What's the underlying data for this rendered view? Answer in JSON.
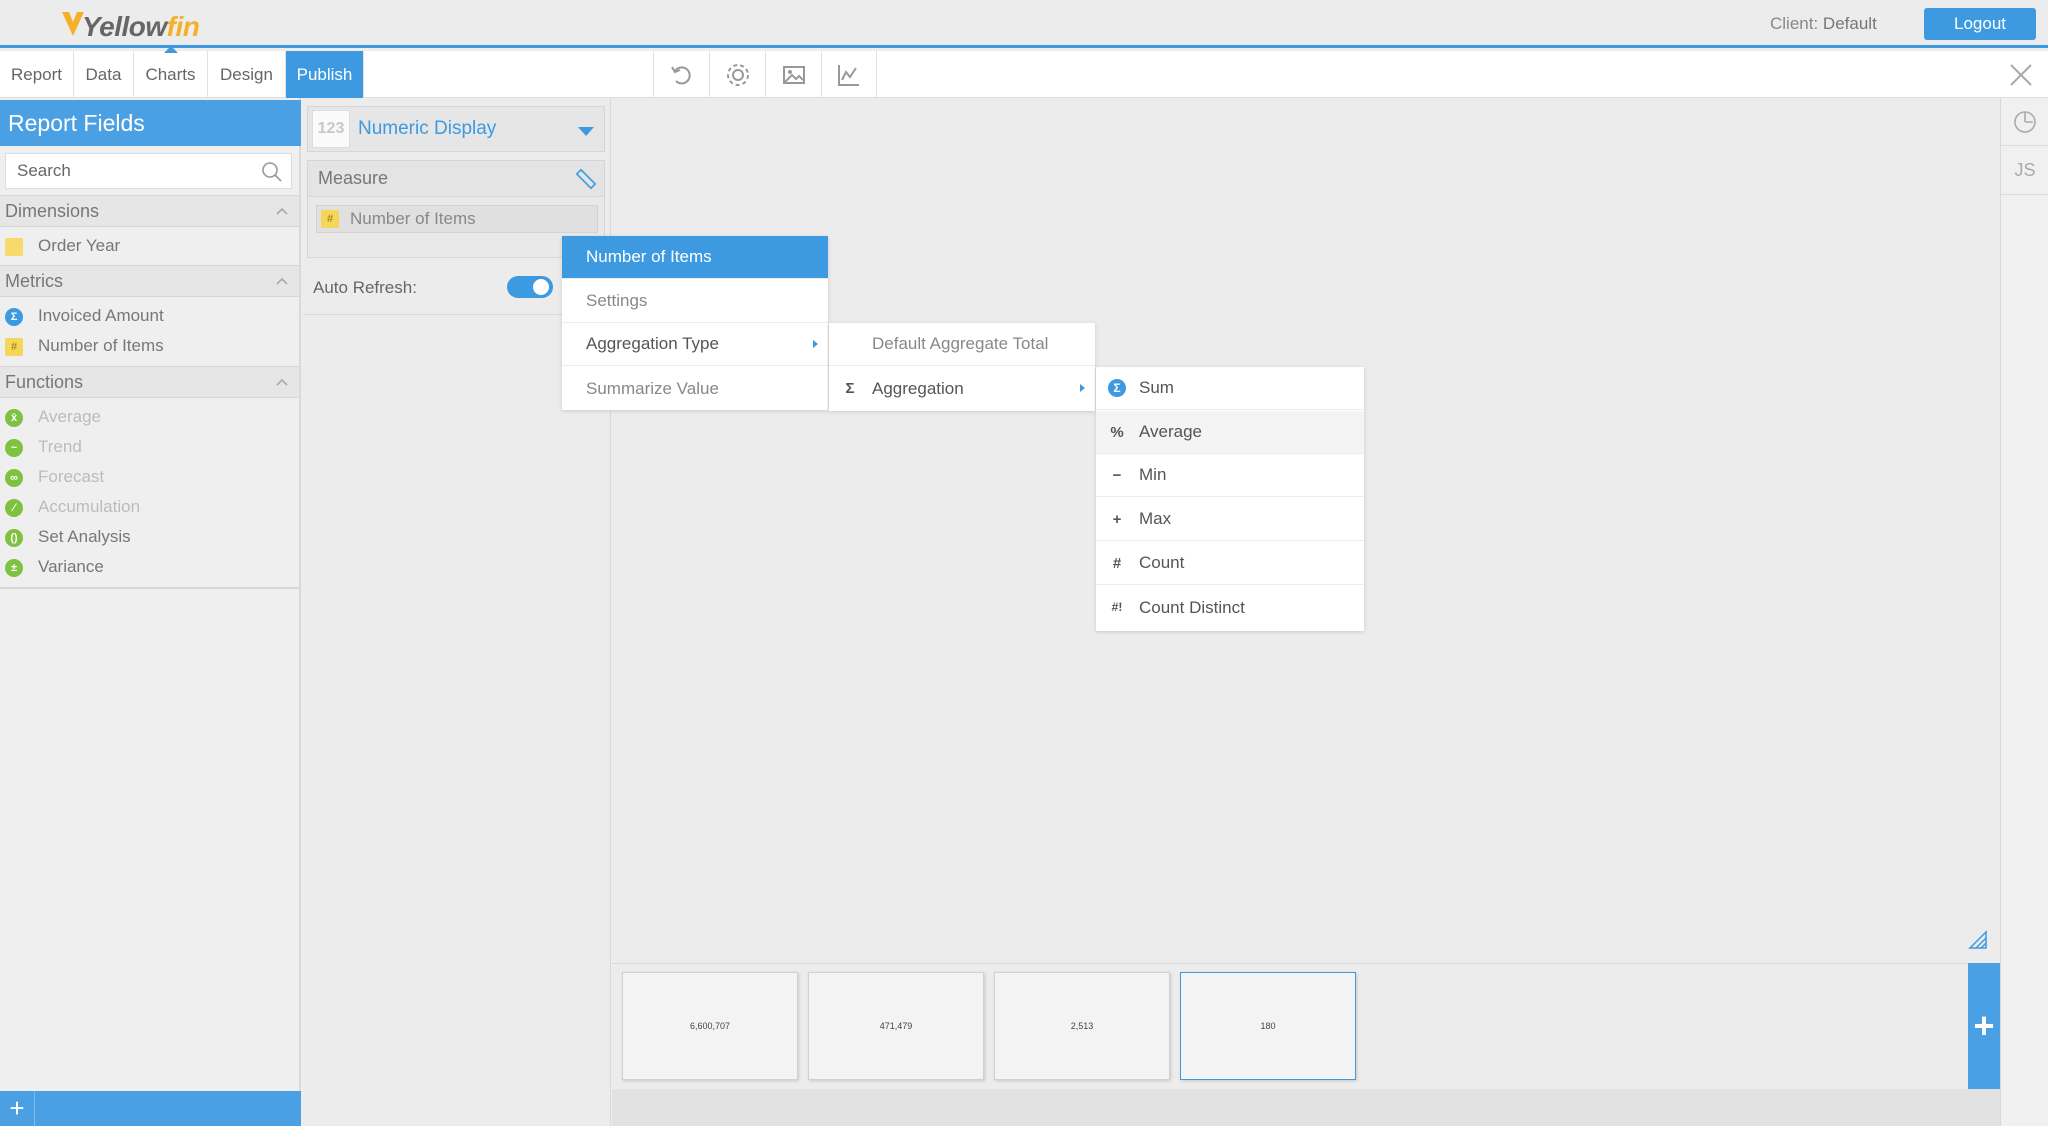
{
  "header": {
    "logo_text_1": "Yellow",
    "logo_text_2": "fin",
    "client_prefix": "Client:",
    "client_name": "Default",
    "logout_label": "Logout"
  },
  "tabs": [
    "Report",
    "Data",
    "Charts",
    "Design",
    "Publish"
  ],
  "active_tab": "Publish",
  "toolbar_icons": [
    "undo-icon",
    "gear-icon",
    "image-icon",
    "line-chart-icon"
  ],
  "left_panel": {
    "title": "Report Fields",
    "search_placeholder": "Search",
    "dimensions_label": "Dimensions",
    "dimensions": [
      {
        "label": "Order Year",
        "icon": "calendar-icon"
      }
    ],
    "metrics_label": "Metrics",
    "metrics": [
      {
        "label": "Invoiced Amount",
        "icon": "sigma-icon"
      },
      {
        "label": "Number of Items",
        "icon": "hash-icon"
      }
    ],
    "functions_label": "Functions",
    "functions": [
      {
        "label": "Average",
        "enabled": false
      },
      {
        "label": "Trend",
        "enabled": false
      },
      {
        "label": "Forecast",
        "enabled": false
      },
      {
        "label": "Accumulation",
        "enabled": false
      },
      {
        "label": "Set Analysis",
        "enabled": true
      },
      {
        "label": "Variance",
        "enabled": true
      }
    ],
    "footer_add": "+"
  },
  "config_panel": {
    "chart_icon_text": "123",
    "chart_type": "Numeric Display",
    "measure_label": "Measure",
    "measure_field": "Number of Items",
    "auto_refresh_label": "Auto Refresh:",
    "auto_refresh_on": true
  },
  "context_menu": {
    "items": [
      "Number of Items",
      "Settings",
      "Aggregation Type",
      "Summarize Value"
    ]
  },
  "aggregation_menu": {
    "items": [
      "Default Aggregate Total",
      "Aggregation"
    ],
    "aggregation_icon": "Σ"
  },
  "aggregation_options": [
    {
      "label": "Sum",
      "icon": "Σ"
    },
    {
      "label": "Average",
      "icon": "%"
    },
    {
      "label": "Min",
      "icon": "−"
    },
    {
      "label": "Max",
      "icon": "+"
    },
    {
      "label": "Count",
      "icon": "#"
    },
    {
      "label": "Count Distinct",
      "icon": "#!"
    }
  ],
  "thumbnails": [
    "6,600,707",
    "471,479",
    "2,513",
    "180"
  ],
  "selected_thumbnail": "180",
  "right_bar": {
    "js_label": "JS"
  },
  "colors": {
    "accent": "#3d9ae0",
    "brand_yellow": "#f3b12a",
    "function_green": "#7fc242"
  }
}
